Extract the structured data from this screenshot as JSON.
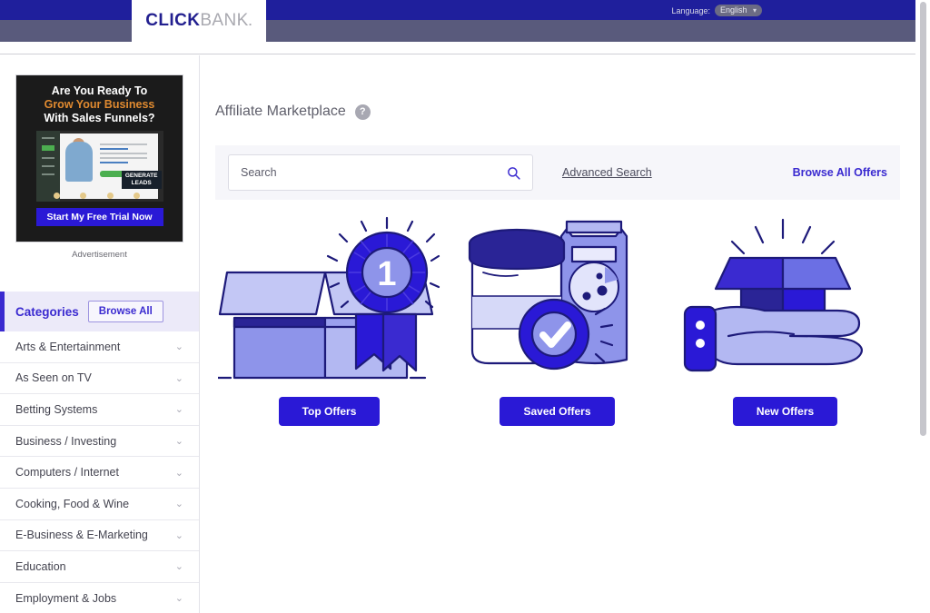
{
  "header": {
    "logo_primary": "CLICK",
    "logo_secondary": "BANK",
    "logo_dot": ".",
    "language_label": "Language:",
    "language_value": "English",
    "language_options": [
      "English"
    ],
    "chevron": "▾"
  },
  "sidebar": {
    "ad": {
      "line1": "Are You Ready To",
      "line2": "Grow Your Business",
      "line3": "With Sales Funnels?",
      "badge_line1": "GENERATE",
      "badge_line2": "LEADS",
      "cta": "Start My Free Trial Now",
      "label": "Advertisement"
    },
    "categories_title": "Categories",
    "browse_all_label": "Browse All",
    "chevron_icon": "⌄",
    "items": [
      {
        "label": "Arts & Entertainment"
      },
      {
        "label": "As Seen on TV"
      },
      {
        "label": "Betting Systems"
      },
      {
        "label": "Business / Investing"
      },
      {
        "label": "Computers / Internet"
      },
      {
        "label": "Cooking, Food & Wine"
      },
      {
        "label": "E-Business & E-Marketing"
      },
      {
        "label": "Education"
      },
      {
        "label": "Employment & Jobs"
      }
    ]
  },
  "main": {
    "page_title": "Affiliate Marketplace",
    "help_glyph": "?",
    "search": {
      "placeholder": "Search",
      "value": "",
      "search_icon": "search-icon"
    },
    "advanced_search_label": "Advanced Search",
    "browse_all_offers_label": "Browse All Offers",
    "cards": [
      {
        "name": "top-offers",
        "button_label": "Top Offers",
        "art": "box-with-award-ribbon",
        "ribbon_number": "1"
      },
      {
        "name": "saved-offers",
        "button_label": "Saved Offers",
        "art": "supplement-jar-bag-with-check-badge"
      },
      {
        "name": "new-offers",
        "button_label": "New Offers",
        "art": "hand-holding-open-box"
      }
    ]
  },
  "colors": {
    "topbar_dark": "#1f1f9c",
    "topbar_mid": "#595a7c",
    "accent_blue": "#3a2ad0",
    "button_blue": "#2a19d6",
    "panel_bg": "#f6f6fa",
    "category_header_bg": "#eceaf9",
    "ad_orange": "#e08a30",
    "illustration_light": "#aeb4ee",
    "illustration_mid": "#6b6fe4",
    "illustration_dark": "#2a19d6",
    "illustration_navy": "#1d1a7a"
  }
}
